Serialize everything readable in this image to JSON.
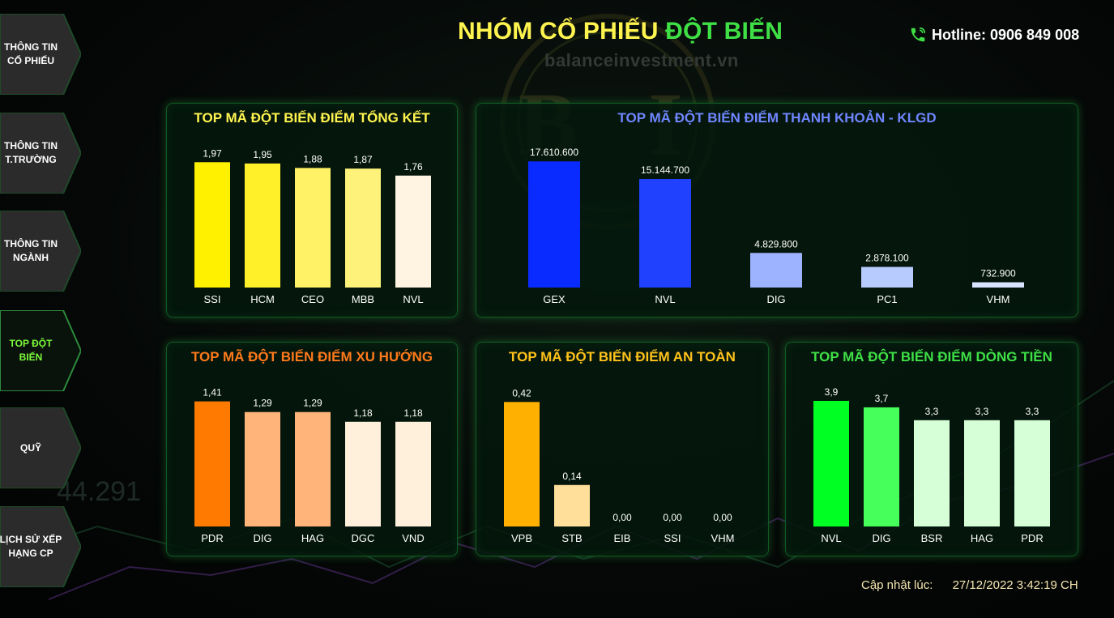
{
  "header": {
    "title_part1": "NHÓM CỔ PHIẾU",
    "title_part2": "ĐỘT BIẾN",
    "watermark": "balanceinvestment.vn",
    "hotline": "Hotline: 0906 849 008"
  },
  "sidebar": {
    "items": [
      {
        "label_line1": "THÔNG TIN",
        "label_line2": "CỔ PHIẾU",
        "active": false
      },
      {
        "label_line1": "THÔNG TIN",
        "label_line2": "T.TRƯỜNG",
        "active": false
      },
      {
        "label_line1": "THÔNG TIN",
        "label_line2": "NGÀNH",
        "active": false
      },
      {
        "label_line1": "TOP ĐỘT",
        "label_line2": "BIẾN",
        "active": true
      },
      {
        "label_line1": "QUỸ",
        "label_line2": "",
        "active": false
      },
      {
        "label_line1": "LỊCH SỬ XẾP",
        "label_line2": "HẠNG CP",
        "active": false
      }
    ]
  },
  "footer": {
    "label": "Cập nhật lúc:",
    "value": "27/12/2022 3:42:19 CH"
  },
  "colors": {
    "yellow_title": "#FFF44F",
    "green_title": "#3FE046",
    "blue_title": "#6F86FF",
    "orange_title": "#FF7A1A",
    "safe_title": "#FFC21A",
    "flow_title": "#3FE046"
  },
  "chart_data": [
    {
      "type": "bar",
      "title": "TOP MÃ ĐỘT BIẾN ĐIỂM TỔNG KẾT",
      "title_color": "#FFF44F",
      "categories": [
        "SSI",
        "HCM",
        "CEO",
        "MBB",
        "NVL"
      ],
      "values": [
        1.97,
        1.95,
        1.88,
        1.87,
        1.76
      ],
      "labels": [
        "1,97",
        "1,95",
        "1,88",
        "1,87",
        "1,76"
      ],
      "colors": [
        "#FFF100",
        "#FFF02A",
        "#FFF266",
        "#FFF27A",
        "#FFF3E2"
      ],
      "ylim": [
        0,
        2.05
      ]
    },
    {
      "type": "bar",
      "title": "TOP MÃ ĐỘT BIẾN ĐIỂM THANH KHOẢN - KLGD",
      "title_color": "#6F86FF",
      "categories": [
        "GEX",
        "NVL",
        "DIG",
        "PC1",
        "VHM"
      ],
      "values": [
        17610600,
        15144700,
        4829800,
        2878100,
        732900
      ],
      "labels": [
        "17.610.600",
        "15.144.700",
        "4.829.800",
        "2.878.100",
        "732.900"
      ],
      "colors": [
        "#0A2BFF",
        "#2042FF",
        "#9DB3FF",
        "#B8CBFF",
        "#D8E4FF"
      ],
      "ylim": [
        0,
        18200000
      ]
    },
    {
      "type": "bar",
      "title": "TOP MÃ ĐỘT BIẾN ĐIỂM XU HƯỚNG",
      "title_color": "#FF7A1A",
      "categories": [
        "PDR",
        "DIG",
        "HAG",
        "DGC",
        "VND"
      ],
      "values": [
        1.41,
        1.29,
        1.29,
        1.18,
        1.18
      ],
      "labels": [
        "1,41",
        "1,29",
        "1,29",
        "1,18",
        "1,18"
      ],
      "colors": [
        "#FF7A00",
        "#FFB47A",
        "#FFB47A",
        "#FFF0DC",
        "#FFF0DC"
      ],
      "ylim": [
        0,
        1.47
      ]
    },
    {
      "type": "bar",
      "title": "TOP MÃ ĐỘT BIẾN ĐIỂM AN TOÀN",
      "title_color": "#FFC21A",
      "categories": [
        "VPB",
        "STB",
        "EIB",
        "SSI",
        "VHM"
      ],
      "values": [
        0.42,
        0.14,
        0.0,
        0.0,
        0.0
      ],
      "labels": [
        "0,42",
        "0,14",
        "0,00",
        "0,00",
        "0,00"
      ],
      "colors": [
        "#FFB000",
        "#FFDF9A",
        "#FFEBC4",
        "#FFEBC4",
        "#FFEBC4"
      ],
      "ylim": [
        0,
        0.44
      ]
    },
    {
      "type": "bar",
      "title": "TOP MÃ ĐỘT BIẾN ĐIỂM DÒNG TIỀN",
      "title_color": "#3FE046",
      "categories": [
        "NVL",
        "DIG",
        "BSR",
        "HAG",
        "PDR"
      ],
      "values": [
        3.9,
        3.7,
        3.3,
        3.3,
        3.3
      ],
      "labels": [
        "3,9",
        "3,7",
        "3,3",
        "3,3",
        "3,3"
      ],
      "colors": [
        "#00FF22",
        "#47FF5A",
        "#D6FFD8",
        "#D6FFD8",
        "#D6FFD8"
      ],
      "ylim": [
        0,
        4.05
      ]
    }
  ]
}
